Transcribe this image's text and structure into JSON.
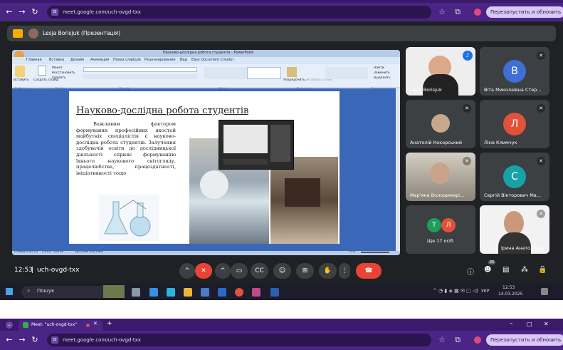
{
  "browser": {
    "url": "meet.google.com/uch-ovgd-txx",
    "relaunch_label": "Перезапустить и обновить",
    "tab_title": "Meet: \"uch-ovgd-txx\"",
    "win_minimize": "–",
    "win_maximize": "□",
    "win_close": "✕",
    "new_tab": "+"
  },
  "presentation_bar": {
    "title": "Lesja Borisjuk (Презентація)"
  },
  "ppt": {
    "window_title": "Науково-дослідна робота студентів - PowerPoint",
    "tabs": [
      "Главная",
      "Вставка",
      "Дизайн",
      "Анимация",
      "Показ слайдов",
      "Рецензирование",
      "Вид",
      "Easy Document Creator"
    ],
    "groups": [
      "Буфер о...",
      "Слайды",
      "Шрифт",
      "Абзац",
      "Рисование",
      "Редактирование"
    ],
    "buttons": [
      "Вставить",
      "Создать слайд",
      "Макет",
      "Восстановить",
      "Удалить",
      "Упорядочить",
      "Экспресс-стили",
      "Найти",
      "Заменить",
      "Выделить"
    ],
    "status": [
      "Слайд 6 из 23",
      "\"Office Theme\"",
      "Русский (Россия)"
    ],
    "zoom": "71%"
  },
  "slide": {
    "title": "Науково-дослідна робота студентів",
    "body": "Важливим фактором формування професійних якостей майбутніх спеціалістів є науково-дослідна робота студентів. Залучення здобувачів освіти до дослідницької діяльності сприяє формуванню їхнього наукового світогляду, працелюбства, працездатності, ініціативності тощо"
  },
  "participants": [
    {
      "name": "Lesja Borisjuk",
      "type": "video",
      "color": "#ffffff"
    },
    {
      "name": "Віта Миколаївна Стер...",
      "initial": "В",
      "color": "#3f6fd4"
    },
    {
      "name": "Анатолій Кокорський",
      "type": "video",
      "color": "#3c4043"
    },
    {
      "name": "Ліна Климчук",
      "initial": "Л",
      "color": "#e0523a"
    },
    {
      "name": "Мар'яна Володимирі...",
      "type": "video",
      "color": "#888"
    },
    {
      "name": "Сергій Вікторович Ма...",
      "initial": "С",
      "color": "#17a2a8"
    },
    {
      "name": "Ще 17 осіб",
      "initials": [
        "Т",
        "Л"
      ],
      "colors": [
        "#1e9e5a",
        "#e0523a"
      ]
    },
    {
      "name": "Ірина Анатоліївна",
      "type": "video",
      "color": "#fff"
    }
  ],
  "meeting": {
    "time": "12:53",
    "code": "uch-ovgd-txx",
    "people_count": "25"
  },
  "taskbar": {
    "search_placeholder": "Пошук",
    "lang": "УКР",
    "time": "12:53",
    "date": "14.03.2025"
  },
  "colors": {
    "accent": "#4a2585",
    "end_call": "#ea4335",
    "meet_bg": "#202124"
  }
}
